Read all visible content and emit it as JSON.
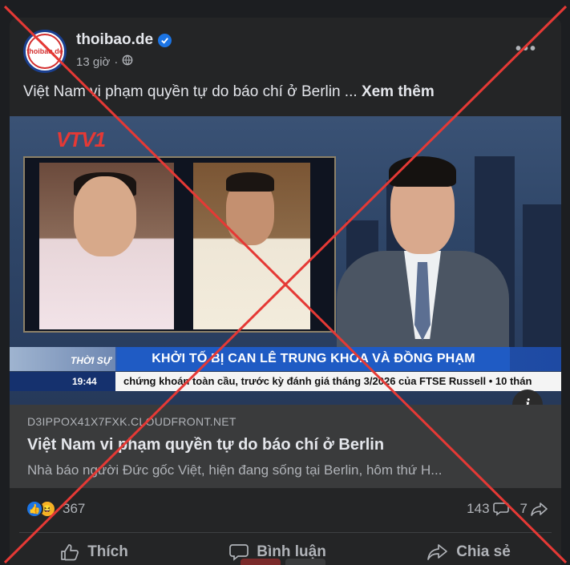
{
  "post": {
    "page_name": "thoibao.de",
    "avatar_text": "thoibao.de",
    "time": "13 giờ",
    "text": "Việt Nam vi phạm quyền tự do báo chí ở Berlin ...",
    "see_more": "Xem thêm"
  },
  "media": {
    "channel_logo": "VTV1",
    "section_tag": "THỜI SỰ",
    "headline": "KHỞI TỐ BỊ CAN LÊ TRUNG KHOA VÀ ĐỒNG PHẠM",
    "clock": "19:44",
    "ticker": "chứng khoán toàn cầu, trước kỳ đánh giá tháng 3/2026 của FTSE Russell  •  10 thán",
    "info_label": "i"
  },
  "link": {
    "domain": "D3IPPOX41X7FXK.CLOUDFRONT.NET",
    "title": "Việt Nam vi phạm quyền tự do báo chí ở Berlin",
    "description": "Nhà báo người Đức gốc Việt, hiện đang sống tại Berlin, hôm thứ H..."
  },
  "stats": {
    "reactions": "367",
    "comments": "143",
    "shares": "7"
  },
  "actions": {
    "like": "Thích",
    "comment": "Bình luận",
    "share": "Chia sẻ"
  },
  "colors": {
    "background": "#1c1e21",
    "card": "#242526",
    "link_box": "#3a3b3c",
    "verified": "#1b74e4",
    "overlay_x": "#e53935"
  }
}
